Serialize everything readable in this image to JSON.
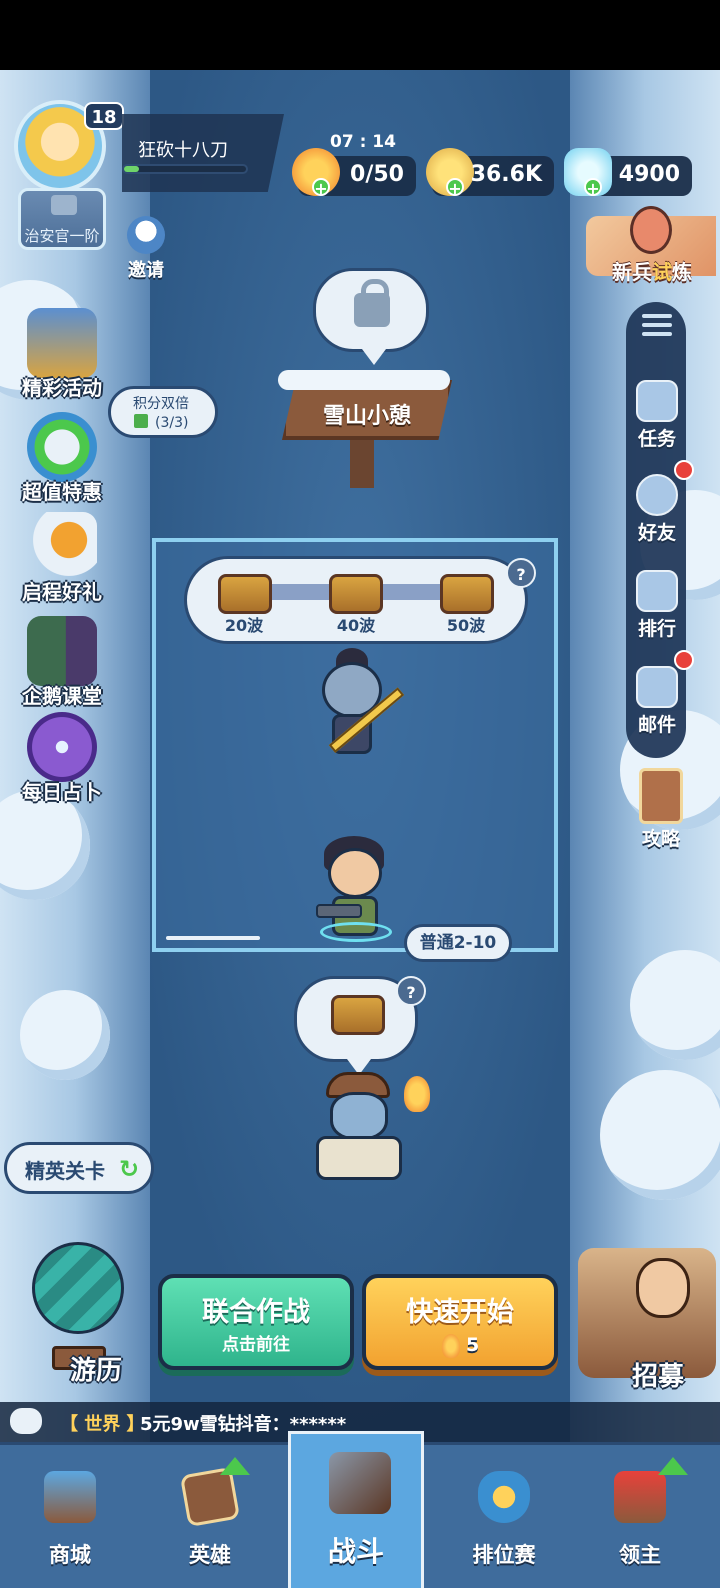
{
  "player": {
    "level": "18",
    "name": "狂砍十八刀",
    "rank": "治安官一阶",
    "xp_progress": 0.12
  },
  "timer": "07 : 14",
  "resources": [
    {
      "icon": "flame-icon",
      "value": "0/50"
    },
    {
      "icon": "gold-coin-icon",
      "value": "36.6K"
    },
    {
      "icon": "diamond-icon",
      "value": "4900"
    }
  ],
  "invite": {
    "label": "邀请"
  },
  "trial": {
    "label_a": "新兵",
    "label_b": "试",
    "label_c": "炼"
  },
  "left_menu": [
    {
      "label": "精彩活动",
      "icon": "treasure-chest-icon"
    },
    {
      "label": "超值特惠",
      "icon": "clock-icon"
    },
    {
      "label": "启程好礼",
      "icon": "griffin-icon"
    },
    {
      "label": "企鹅课堂",
      "icon": "penguin-icon"
    },
    {
      "label": "每日占卜",
      "icon": "crystal-ball-icon"
    }
  ],
  "points_bubble": {
    "title": "积分双倍",
    "count": "(3/3)"
  },
  "right_menu": [
    {
      "label": "任务",
      "icon": "task-icon"
    },
    {
      "label": "好友",
      "icon": "friends-icon"
    },
    {
      "label": "排行",
      "icon": "ranking-icon"
    },
    {
      "label": "邮件",
      "icon": "mail-icon"
    }
  ],
  "guide": {
    "label": "攻略"
  },
  "rest_sign": {
    "label": "雪山小憩"
  },
  "wave_rewards": [
    {
      "label": "20波"
    },
    {
      "label": "40波"
    },
    {
      "label": "50波"
    }
  ],
  "stage_tag": "普通2-10",
  "elite": {
    "label": "精英关卡"
  },
  "travel": {
    "label": "游历"
  },
  "recruit": {
    "label": "招募"
  },
  "coop_button": {
    "title": "联合作战",
    "subtitle": "点击前往"
  },
  "quick_button": {
    "title": "快速开始",
    "cost": "5"
  },
  "chat": {
    "channel": "【 世界 】",
    "message": "5元9w雪钻抖音：******"
  },
  "bottom_nav": [
    {
      "label": "商城",
      "icon": "shop-icon"
    },
    {
      "label": "英雄",
      "icon": "hero-card-icon"
    },
    {
      "label": "战斗",
      "icon": "battle-icon"
    },
    {
      "label": "排位赛",
      "icon": "ranked-shield-icon"
    },
    {
      "label": "领主",
      "icon": "lord-banner-icon"
    }
  ],
  "colors": {
    "accent_green": "#4cc84c",
    "accent_gold": "#ffd25b",
    "panel": "#1a2e4a",
    "red_dot": "#e8413b"
  }
}
